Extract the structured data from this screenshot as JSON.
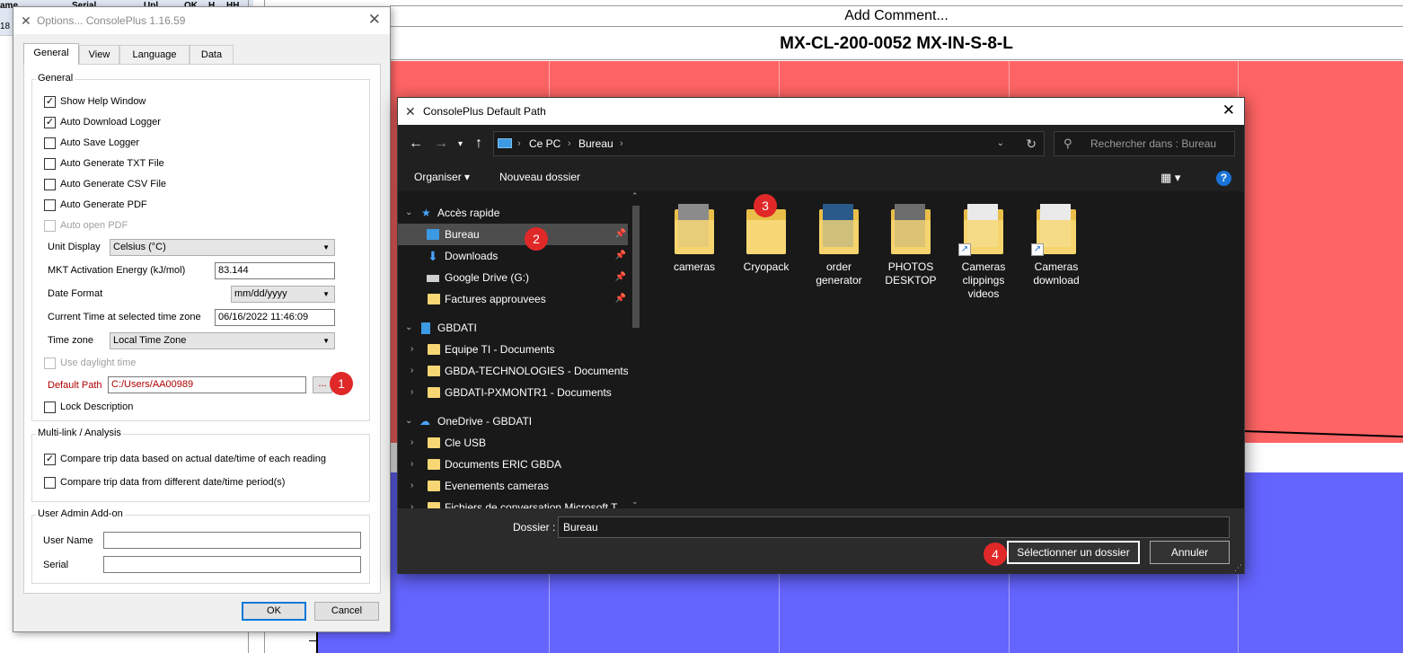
{
  "background_app": {
    "grid_header": [
      "ame",
      "Serial",
      "Upl",
      "OK",
      "H",
      "HH"
    ],
    "row_number": "18",
    "comment_label": "Add Comment...",
    "chart_title": "MX-CL-200-0052 MX-IN-S-8-L",
    "colors": {
      "upper_zone": "#ff6464",
      "lower_zone": "#6464ff"
    }
  },
  "options_dialog": {
    "title": "Options... ConsolePlus 1.16.59",
    "tabs": [
      "General",
      "View",
      "Language",
      "Data"
    ],
    "active_tab": "General",
    "general_group": {
      "label": "General",
      "checkboxes": [
        {
          "label": "Show Help Window",
          "checked": "✓",
          "enabled": true
        },
        {
          "label": "Auto Download Logger",
          "checked": "✓",
          "enabled": true
        },
        {
          "label": "Auto Save Logger",
          "checked": "",
          "enabled": true
        },
        {
          "label": "Auto Generate TXT File",
          "checked": "",
          "enabled": true
        },
        {
          "label": "Auto Generate CSV File",
          "checked": "",
          "enabled": true
        },
        {
          "label": "Auto Generate PDF",
          "checked": "",
          "enabled": true
        },
        {
          "label": "Auto open PDF",
          "checked": "",
          "enabled": false
        }
      ],
      "unit_display_label": "Unit Display",
      "unit_display_value": "Celsius (°C)",
      "mkt_label": "MKT Activation Energy (kJ/mol)",
      "mkt_value": "83.144",
      "date_format_label": "Date Format",
      "date_format_value": "mm/dd/yyyy",
      "current_time_label": "Current Time at selected time zone",
      "current_time_value": "06/16/2022 11:46:09",
      "time_zone_label": "Time zone",
      "time_zone_value": "Local Time Zone",
      "daylight_label": "Use daylight time",
      "default_path_label": "Default Path",
      "default_path_value": "C:/Users/AA00989",
      "browse_label": "...",
      "lock_description_label": "Lock Description"
    },
    "multilink_group": {
      "label": "Multi-link / Analysis",
      "checkboxes": [
        {
          "label": "Compare trip data based on actual date/time of each reading",
          "checked": "✓"
        },
        {
          "label": "Compare trip data from different date/time period(s)",
          "checked": ""
        }
      ]
    },
    "admin_group": {
      "label": "User Admin Add-on",
      "user_name_label": "User Name",
      "serial_label": "Serial",
      "user_name_value": "",
      "serial_value": ""
    },
    "ok_label": "OK",
    "cancel_label": "Cancel"
  },
  "folder_dialog": {
    "title": "ConsolePlus Default Path",
    "breadcrumb": [
      "Ce PC",
      "Bureau"
    ],
    "search_placeholder": "Rechercher dans : Bureau",
    "organize_label": "Organiser",
    "new_folder_label": "Nouveau dossier",
    "help_label": "?",
    "tree": [
      {
        "label": "Accès rapide",
        "level": 0,
        "icon": "star-icon"
      },
      {
        "label": "Bureau",
        "level": 1,
        "icon": "desktop-icon",
        "selected": true,
        "pinned": true
      },
      {
        "label": "Downloads",
        "level": 1,
        "icon": "download-icon",
        "pinned": true
      },
      {
        "label": "Google Drive (G:)",
        "level": 1,
        "icon": "drive-icon",
        "pinned": true
      },
      {
        "label": "Factures approuvees",
        "level": 1,
        "icon": "folder-icon",
        "pinned": true
      },
      {
        "label": "GBDATI",
        "level": 0,
        "icon": "building-icon"
      },
      {
        "label": "Equipe TI - Documents",
        "level": 1,
        "icon": "folder-icon"
      },
      {
        "label": "GBDA-TECHNOLOGIES - Documents",
        "level": 1,
        "icon": "folder-icon"
      },
      {
        "label": "GBDATI-PXMONTR1 - Documents",
        "level": 1,
        "icon": "folder-icon"
      },
      {
        "label": "OneDrive - GBDATI",
        "level": 0,
        "icon": "cloud-icon"
      },
      {
        "label": "Cle USB",
        "level": 1,
        "icon": "folder-icon"
      },
      {
        "label": "Documents ERIC GBDA",
        "level": 1,
        "icon": "folder-icon"
      },
      {
        "label": "Evenements cameras",
        "level": 1,
        "icon": "folder-icon"
      },
      {
        "label": "Fichiers de conversation Microsoft T",
        "level": 1,
        "icon": "folder-icon"
      }
    ],
    "items": [
      {
        "label": "cameras",
        "shortcut": false
      },
      {
        "label": "Cryopack",
        "shortcut": false
      },
      {
        "label": "order generator",
        "shortcut": false
      },
      {
        "label": "PHOTOS DESKTOP",
        "shortcut": false
      },
      {
        "label": "Cameras clippings videos",
        "shortcut": true
      },
      {
        "label": "Cameras download",
        "shortcut": true
      }
    ],
    "folder_label": "Dossier :",
    "folder_value": "Bureau",
    "select_label": "Sélectionner un dossier",
    "cancel_label": "Annuler"
  },
  "annotations": [
    "1",
    "2",
    "3",
    "4"
  ]
}
